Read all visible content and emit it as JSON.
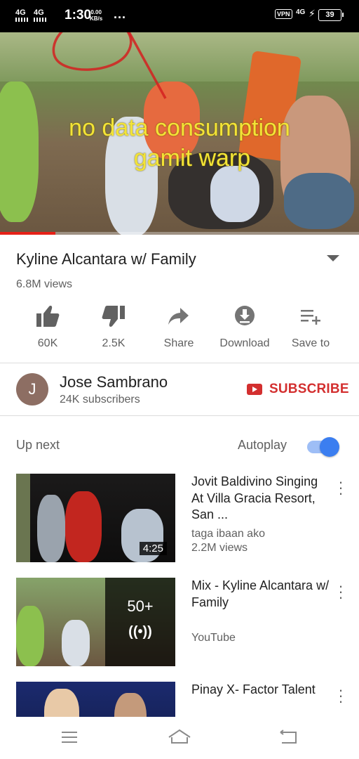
{
  "status_bar": {
    "network1": "4G",
    "network2": "4G",
    "time": "1:30",
    "speed_value": "0.00",
    "speed_unit": "KB/s",
    "more": "...",
    "vpn": "VPN",
    "network3": "4G",
    "battery": "39"
  },
  "video": {
    "overlay_line1": "no data consumption",
    "overlay_line2": "gamit warp",
    "progress": 0.155
  },
  "details": {
    "title": "Kyline Alcantara w/ Family",
    "views": "6.8M views"
  },
  "actions": [
    {
      "label": "60K",
      "icon": "thumbs-up-icon"
    },
    {
      "label": "2.5K",
      "icon": "thumbs-down-icon"
    },
    {
      "label": "Share",
      "icon": "share-icon"
    },
    {
      "label": "Download",
      "icon": "download-icon"
    },
    {
      "label": "Save to",
      "icon": "playlist-add-icon"
    }
  ],
  "channel": {
    "avatar_letter": "J",
    "name": "Jose Sambrano",
    "subscribers": "24K subscribers",
    "subscribe_label": "SUBSCRIBE"
  },
  "up_next": {
    "label": "Up next",
    "autoplay_label": "Autoplay",
    "autoplay_on": true
  },
  "videos": [
    {
      "title": "Jovit Baldivino Singing At Villa Gracia Resort, San ...",
      "channel": "taga ibaan ako",
      "views": "2.2M views",
      "duration": "4:25"
    },
    {
      "title": "Mix - Kyline Alcantara w/ Family",
      "channel": "YouTube",
      "mix_count": "50+"
    },
    {
      "title": "Pinay X- Factor Talent"
    }
  ],
  "colors": {
    "brand_red": "#d32f2f",
    "overlay_yellow": "#f3e436",
    "toggle_blue": "#3b7ef0"
  }
}
